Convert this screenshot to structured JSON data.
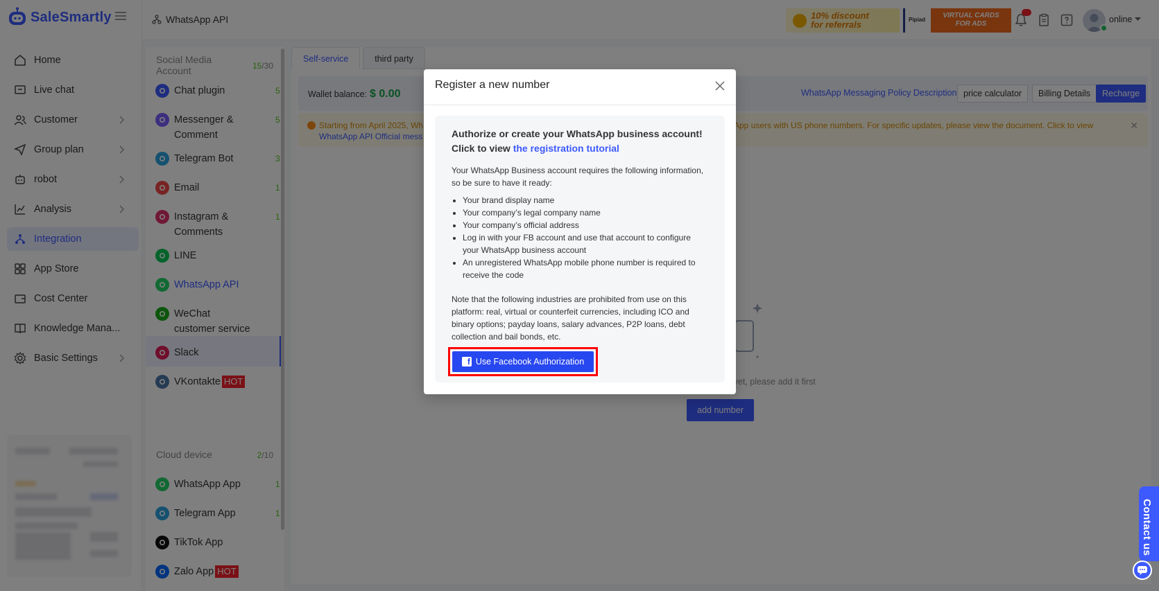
{
  "app": {
    "name": "SaleSmartly"
  },
  "nav": {
    "items": [
      {
        "label": "Home",
        "icon": "home-icon",
        "chevron": false,
        "active": false
      },
      {
        "label": "Live chat",
        "icon": "chat-icon",
        "chevron": false,
        "active": false
      },
      {
        "label": "Customer",
        "icon": "users-icon",
        "chevron": true,
        "active": false
      },
      {
        "label": "Group plan",
        "icon": "send-icon",
        "chevron": true,
        "active": false
      },
      {
        "label": "robot",
        "icon": "robot-icon",
        "chevron": true,
        "active": false
      },
      {
        "label": "Analysis",
        "icon": "chart-icon",
        "chevron": true,
        "active": false
      },
      {
        "label": "Integration",
        "icon": "integration-icon",
        "chevron": false,
        "active": true
      },
      {
        "label": "App Store",
        "icon": "apps-icon",
        "chevron": false,
        "active": false
      },
      {
        "label": "Cost Center",
        "icon": "wallet-icon",
        "chevron": false,
        "active": false
      },
      {
        "label": "Knowledge Mana...",
        "icon": "book-icon",
        "chevron": false,
        "active": false
      },
      {
        "label": "Basic Settings",
        "icon": "gear-icon",
        "chevron": true,
        "active": false
      }
    ]
  },
  "header": {
    "breadcrumb": "WhatsApp API",
    "promo1": "10% discount\nfor referrals",
    "promo2_brand": "Pipiad",
    "promo2": "VIRTUAL CARDS\nFOR ADS",
    "status": "online"
  },
  "channels": {
    "social_heading": "Social Media Account",
    "social_count": "15",
    "social_total": "/30",
    "social": [
      {
        "label": "Chat plugin",
        "count": "5",
        "color": "#3d5afe",
        "icon": "chat-plugin-icon"
      },
      {
        "label": "Messenger & Comment",
        "count": "5",
        "color": "#7b5cff",
        "icon": "messenger-icon"
      },
      {
        "label": "Telegram Bot",
        "count": "3",
        "color": "#2aa3e0",
        "icon": "telegram-icon"
      },
      {
        "label": "Email",
        "count": "1",
        "color": "#f04848",
        "icon": "email-icon"
      },
      {
        "label": "Instagram & Comments",
        "count": "1",
        "color": "#e1306c",
        "icon": "instagram-icon"
      },
      {
        "label": "LINE",
        "count": "",
        "color": "#06c755",
        "icon": "line-icon"
      },
      {
        "label": "WhatsApp API",
        "count": "",
        "color": "#25d366",
        "icon": "whatsapp-icon"
      },
      {
        "label": "WeChat customer service",
        "count": "",
        "color": "#1aad19",
        "icon": "wechat-icon"
      },
      {
        "label": "Slack",
        "count": "",
        "color": "#e01e5a",
        "icon": "slack-icon"
      },
      {
        "label": "VKontakte",
        "count": "",
        "color": "#4a76a8",
        "icon": "vk-icon",
        "hot": "HOT"
      }
    ],
    "cloud_heading": "Cloud device",
    "cloud_count": "2",
    "cloud_total": "/10",
    "cloud": [
      {
        "label": "WhatsApp App",
        "count": "1",
        "color": "#25d366",
        "icon": "whatsapp-app-icon"
      },
      {
        "label": "Telegram App",
        "count": "1",
        "color": "#2aa3e0",
        "icon": "telegram-app-icon"
      },
      {
        "label": "TikTok App",
        "count": "",
        "color": "#111111",
        "icon": "tiktok-icon"
      },
      {
        "label": "Zalo App",
        "count": "",
        "color": "#0068ff",
        "icon": "zalo-icon",
        "hot": "HOT"
      }
    ]
  },
  "main": {
    "tabs": [
      "Self-service",
      "third party"
    ],
    "wallet_label": "Wallet balance:",
    "wallet_value": "$ 0.00",
    "policy_link": "WhatsApp Messaging Policy Description",
    "btn_price": "price calculator",
    "btn_billing": "Billing Details",
    "btn_recharge": "Recharge",
    "notice_1": "Starting from April 2025, Wh",
    "notice_2": "atsApp users with US phone numbers. For specific updates, please view the document. Click to view",
    "notice_3": "WhatsApp API Official mess",
    "empty_text": "r yet, please add it first",
    "add_number": "add number"
  },
  "modal": {
    "title": "Register a new number",
    "heading_1": "Authorize or create your WhatsApp business account!",
    "heading_2": "Click to view ",
    "heading_link": "the registration tutorial",
    "intro": "Your WhatsApp Business account requires the following information, so be sure to have it ready:",
    "requirements": [
      "Your brand display name",
      "Your company’s legal company name",
      "Your company’s official address",
      "Log in with your FB account and use that account to configure your WhatsApp business account",
      "An unregistered WhatsApp mobile phone number is required to receive the code"
    ],
    "note": "Note that the following industries are prohibited from use on this platform: real, virtual or counterfeit currencies, including ICO and binary options; payday loans, salary advances, P2P loans, debt collection and bail bonds, etc.",
    "fb_button": "Use Facebook Authorization"
  },
  "contact": {
    "label": "Contact us"
  },
  "colors": {
    "accent": "#3d5afe",
    "success": "#52c41a",
    "danger": "#f5222d",
    "warning": "#d48806"
  }
}
